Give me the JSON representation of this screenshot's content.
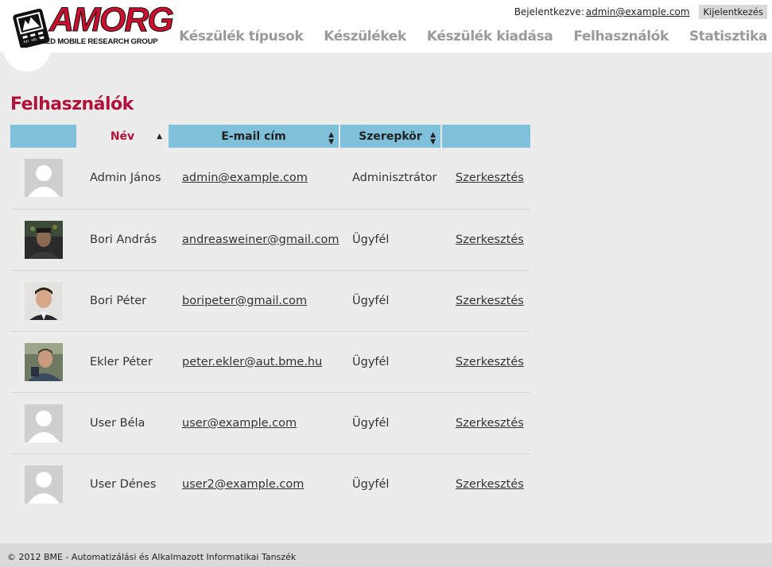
{
  "logo": {
    "brand": "AMORG",
    "subtitle": "APPLIED MOBILE RESEARCH GROUP"
  },
  "session": {
    "label": "Bejelentkezve:",
    "user_email": "admin@example.com",
    "logout_label": "Kijelentkezés"
  },
  "nav": {
    "device_types": "Készülék típusok",
    "devices": "Készülékek",
    "device_issue": "Készülék kiadása",
    "users": "Felhasználók",
    "statistics": "Statisztika"
  },
  "page": {
    "title": "Felhasználók"
  },
  "table": {
    "headers": {
      "name": "Név",
      "email": "E-mail cím",
      "role": "Szerepkör"
    },
    "rows": [
      {
        "name": "Admin János",
        "email": "admin@example.com",
        "role": "Adminisztrátor",
        "action": "Szerkesztés",
        "avatar": "default"
      },
      {
        "name": "Bori András",
        "email": "andreasweiner@gmail.com",
        "role": "Ügyfél",
        "action": "Szerkesztés",
        "avatar": "photo"
      },
      {
        "name": "Bori Péter",
        "email": "boripeter@gmail.com",
        "role": "Ügyfél",
        "action": "Szerkesztés",
        "avatar": "photo"
      },
      {
        "name": "Ekler Péter",
        "email": "peter.ekler@aut.bme.hu",
        "role": "Ügyfél",
        "action": "Szerkesztés",
        "avatar": "photo"
      },
      {
        "name": "User Béla",
        "email": "user@example.com",
        "role": "Ügyfél",
        "action": "Szerkesztés",
        "avatar": "default"
      },
      {
        "name": "User Dénes",
        "email": "user2@example.com",
        "role": "Ügyfél",
        "action": "Szerkesztés",
        "avatar": "default"
      }
    ]
  },
  "footer": {
    "text": "© 2012 BME - Automatizálási és Alkalmazott Informatikai Tanszék"
  },
  "colors": {
    "accent": "#b0123a",
    "table_header": "#7fc0da",
    "background": "#ececec"
  }
}
